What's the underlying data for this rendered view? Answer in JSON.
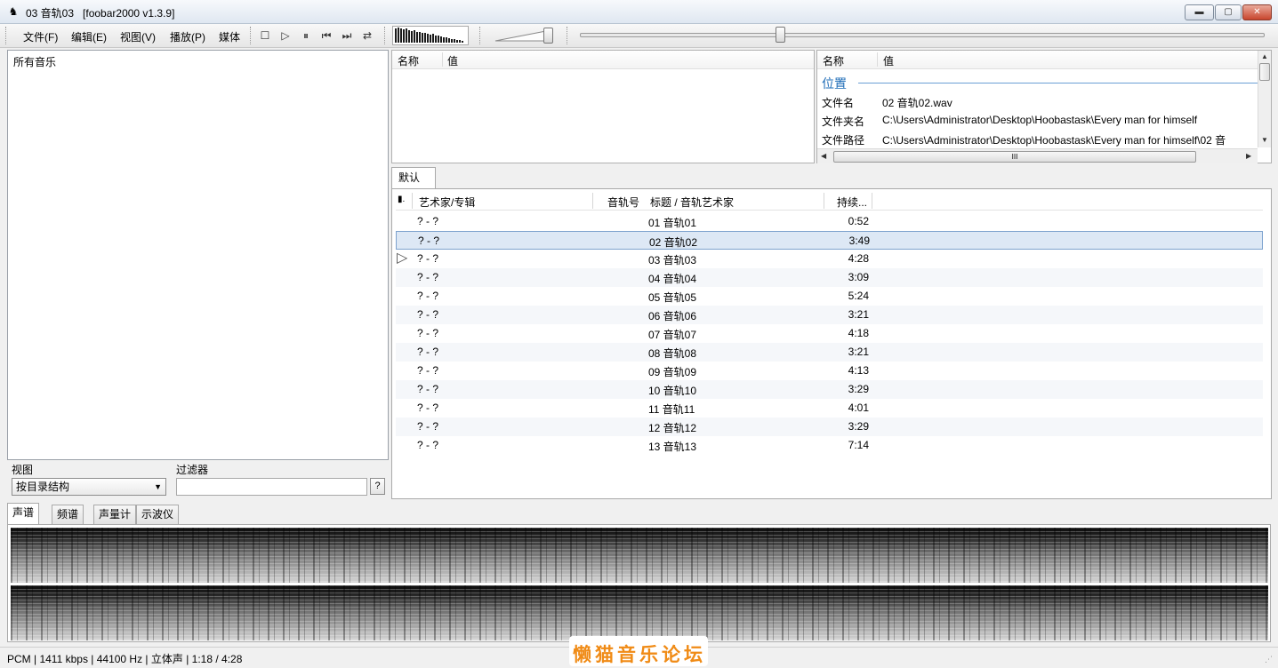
{
  "window": {
    "title": "03 音轨03   [foobar2000 v1.3.9]",
    "app_icon": "♞",
    "minimize_label": "▬",
    "maximize_label": "▢",
    "close_label": "✕"
  },
  "menu": {
    "items": [
      "文件(F)",
      "编辑(E)",
      "视图(V)",
      "播放(P)",
      "媒体"
    ]
  },
  "toolbar": {
    "buttons": [
      {
        "name": "stop-icon",
        "glyph": "☐"
      },
      {
        "name": "play-icon",
        "glyph": "▷"
      },
      {
        "name": "pause-icon",
        "glyph": "⏸"
      },
      {
        "name": "previous-icon",
        "glyph": "⏮"
      },
      {
        "name": "next-icon",
        "glyph": "⏭"
      },
      {
        "name": "random-icon",
        "glyph": "⇄"
      }
    ],
    "volume_level": 0.85,
    "seek_position": 0.29
  },
  "library": {
    "root": "所有音乐",
    "view_label": "视图",
    "filter_label": "过滤器",
    "view_value": "按目录结构",
    "view_arrow": "▼",
    "filter_value": "",
    "filter_help": "?"
  },
  "properties_left": {
    "col_name": "名称",
    "col_value": "值"
  },
  "properties_right": {
    "col_name": "名称",
    "col_value": "值",
    "group": "位置",
    "rows": [
      {
        "name": "文件名",
        "value": "02 音轨02.wav"
      },
      {
        "name": "文件夹名",
        "value": "C:\\Users\\Administrator\\Desktop\\Hoobastask\\Every man for himself"
      },
      {
        "name": "文件路径",
        "value": "C:\\Users\\Administrator\\Desktop\\Hoobastask\\Every man for himself\\02 音"
      }
    ],
    "hscroll_grip": "III",
    "scroll_up": "▲",
    "scroll_down": "▼",
    "scroll_left": "◀",
    "scroll_right": "▶"
  },
  "playlist": {
    "tab": "默认",
    "columns": {
      "playing": "▮.",
      "artist_album": "艺术家/专辑",
      "track_no": "音轨号",
      "title_artist": "标题 / 音轨艺术家",
      "duration": "持续..."
    },
    "rows": [
      {
        "artist": "? - ?",
        "title": "01 音轨01",
        "duration": "0:52"
      },
      {
        "artist": "? - ?",
        "title": "02 音轨02",
        "duration": "3:49"
      },
      {
        "artist": "? - ?",
        "title": "03 音轨03",
        "duration": "4:28"
      },
      {
        "artist": "? - ?",
        "title": "04 音轨04",
        "duration": "3:09"
      },
      {
        "artist": "? - ?",
        "title": "05 音轨05",
        "duration": "5:24"
      },
      {
        "artist": "? - ?",
        "title": "06 音轨06",
        "duration": "3:21"
      },
      {
        "artist": "? - ?",
        "title": "07 音轨07",
        "duration": "4:18"
      },
      {
        "artist": "? - ?",
        "title": "08 音轨08",
        "duration": "3:21"
      },
      {
        "artist": "? - ?",
        "title": "09 音轨09",
        "duration": "4:13"
      },
      {
        "artist": "? - ?",
        "title": "10 音轨10",
        "duration": "3:29"
      },
      {
        "artist": "? - ?",
        "title": "11 音轨11",
        "duration": "4:01"
      },
      {
        "artist": "? - ?",
        "title": "12 音轨12",
        "duration": "3:29"
      },
      {
        "artist": "? - ?",
        "title": "13 音轨13",
        "duration": "7:14"
      }
    ],
    "selected_index": 1,
    "playing_index": 2,
    "play_marker": "▷"
  },
  "vis_tabs": [
    "声谱",
    "频谱",
    "声量计",
    "示波仪"
  ],
  "status": {
    "text": "PCM | 1411 kbps | 44100 Hz | 立体声 | 1:18 / 4:28"
  },
  "watermark": "懒猫音乐论坛",
  "resize_grip": "⋰"
}
